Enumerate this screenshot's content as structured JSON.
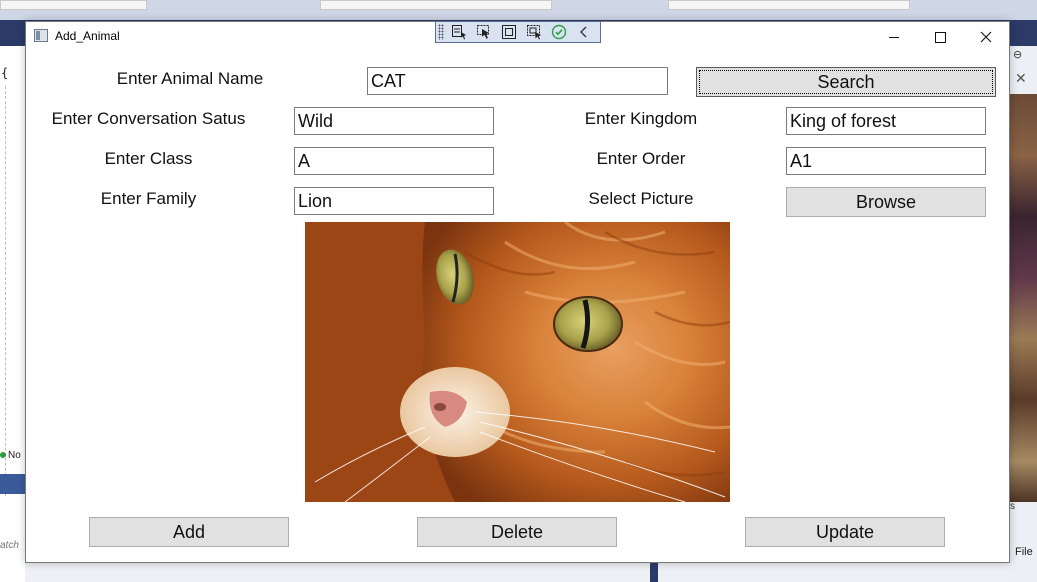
{
  "window": {
    "title": "Add_Animal",
    "controls": {
      "minimize_icon": "minimize-icon",
      "maximize_icon": "maximize-icon",
      "close_icon": "close-icon"
    }
  },
  "debug_toolbar": {
    "icons": [
      "select-element-icon",
      "pointer-icon",
      "display-layout-icon",
      "track-focus-icon",
      "check-icon",
      "collapse-chevron-icon"
    ]
  },
  "form": {
    "animal_name": {
      "label": "Enter Animal Name",
      "value": "CAT"
    },
    "search_button": "Search",
    "conservation_status": {
      "label": "Enter Conversation Satus",
      "value": "Wild"
    },
    "kingdom": {
      "label": "Enter Kingdom",
      "value": "King of forest"
    },
    "class": {
      "label": "Enter Class",
      "value": "A"
    },
    "order": {
      "label": "Enter Order",
      "value": "A1"
    },
    "family": {
      "label": "Enter Family",
      "value": "Lion"
    },
    "picture": {
      "label": "Select Picture",
      "browse_button": "Browse",
      "image_subject": "orange tabby cat close-up"
    }
  },
  "actions": {
    "add": "Add",
    "delete": "Delete",
    "update": "Update"
  },
  "background": {
    "left_status": "No",
    "left_search_hint": "atch",
    "right_menu": "File",
    "right_text": "s"
  },
  "colors": {
    "button_face": "#e1e1e1",
    "button_border": "#adadad",
    "window_bg": "#ffffff",
    "ide_dark_blue": "#2b3a67"
  }
}
